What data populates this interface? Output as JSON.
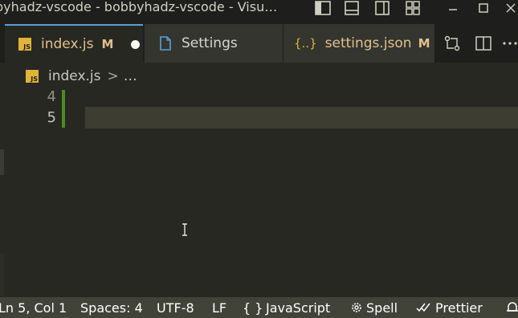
{
  "window": {
    "title": "byhadz-vscode - bobbyhadz-vscode - Visu…"
  },
  "tabs": [
    {
      "label": "index.js",
      "modified_badge": "M",
      "icon": "js-file-icon",
      "badge_text": "JS"
    },
    {
      "label": "Settings",
      "icon": "settings-file-icon"
    },
    {
      "label": "settings.json",
      "modified_badge": "M",
      "icon": "json-braces-icon",
      "icon_text": "{..}"
    }
  ],
  "breadcrumb": {
    "file": "index.js",
    "separator": ">",
    "more": "…",
    "badge_text": "JS"
  },
  "editor": {
    "line_numbers": [
      "4",
      "5"
    ],
    "current_line": "5"
  },
  "status_bar": {
    "position": "Ln 5, Col 1",
    "spaces": "Spaces: 4",
    "encoding": "UTF-8",
    "eol": "LF",
    "language_braces": "{ }",
    "language": "JavaScript",
    "spell": "Spell",
    "prettier": "Prettier"
  },
  "colors": {
    "accent_tab_border": "#5a9fd4",
    "modified": "#e2c08d",
    "js_badge": "#e0b43a",
    "gutter_added": "#4d8a1f",
    "status_bar_bg": "#414339"
  }
}
